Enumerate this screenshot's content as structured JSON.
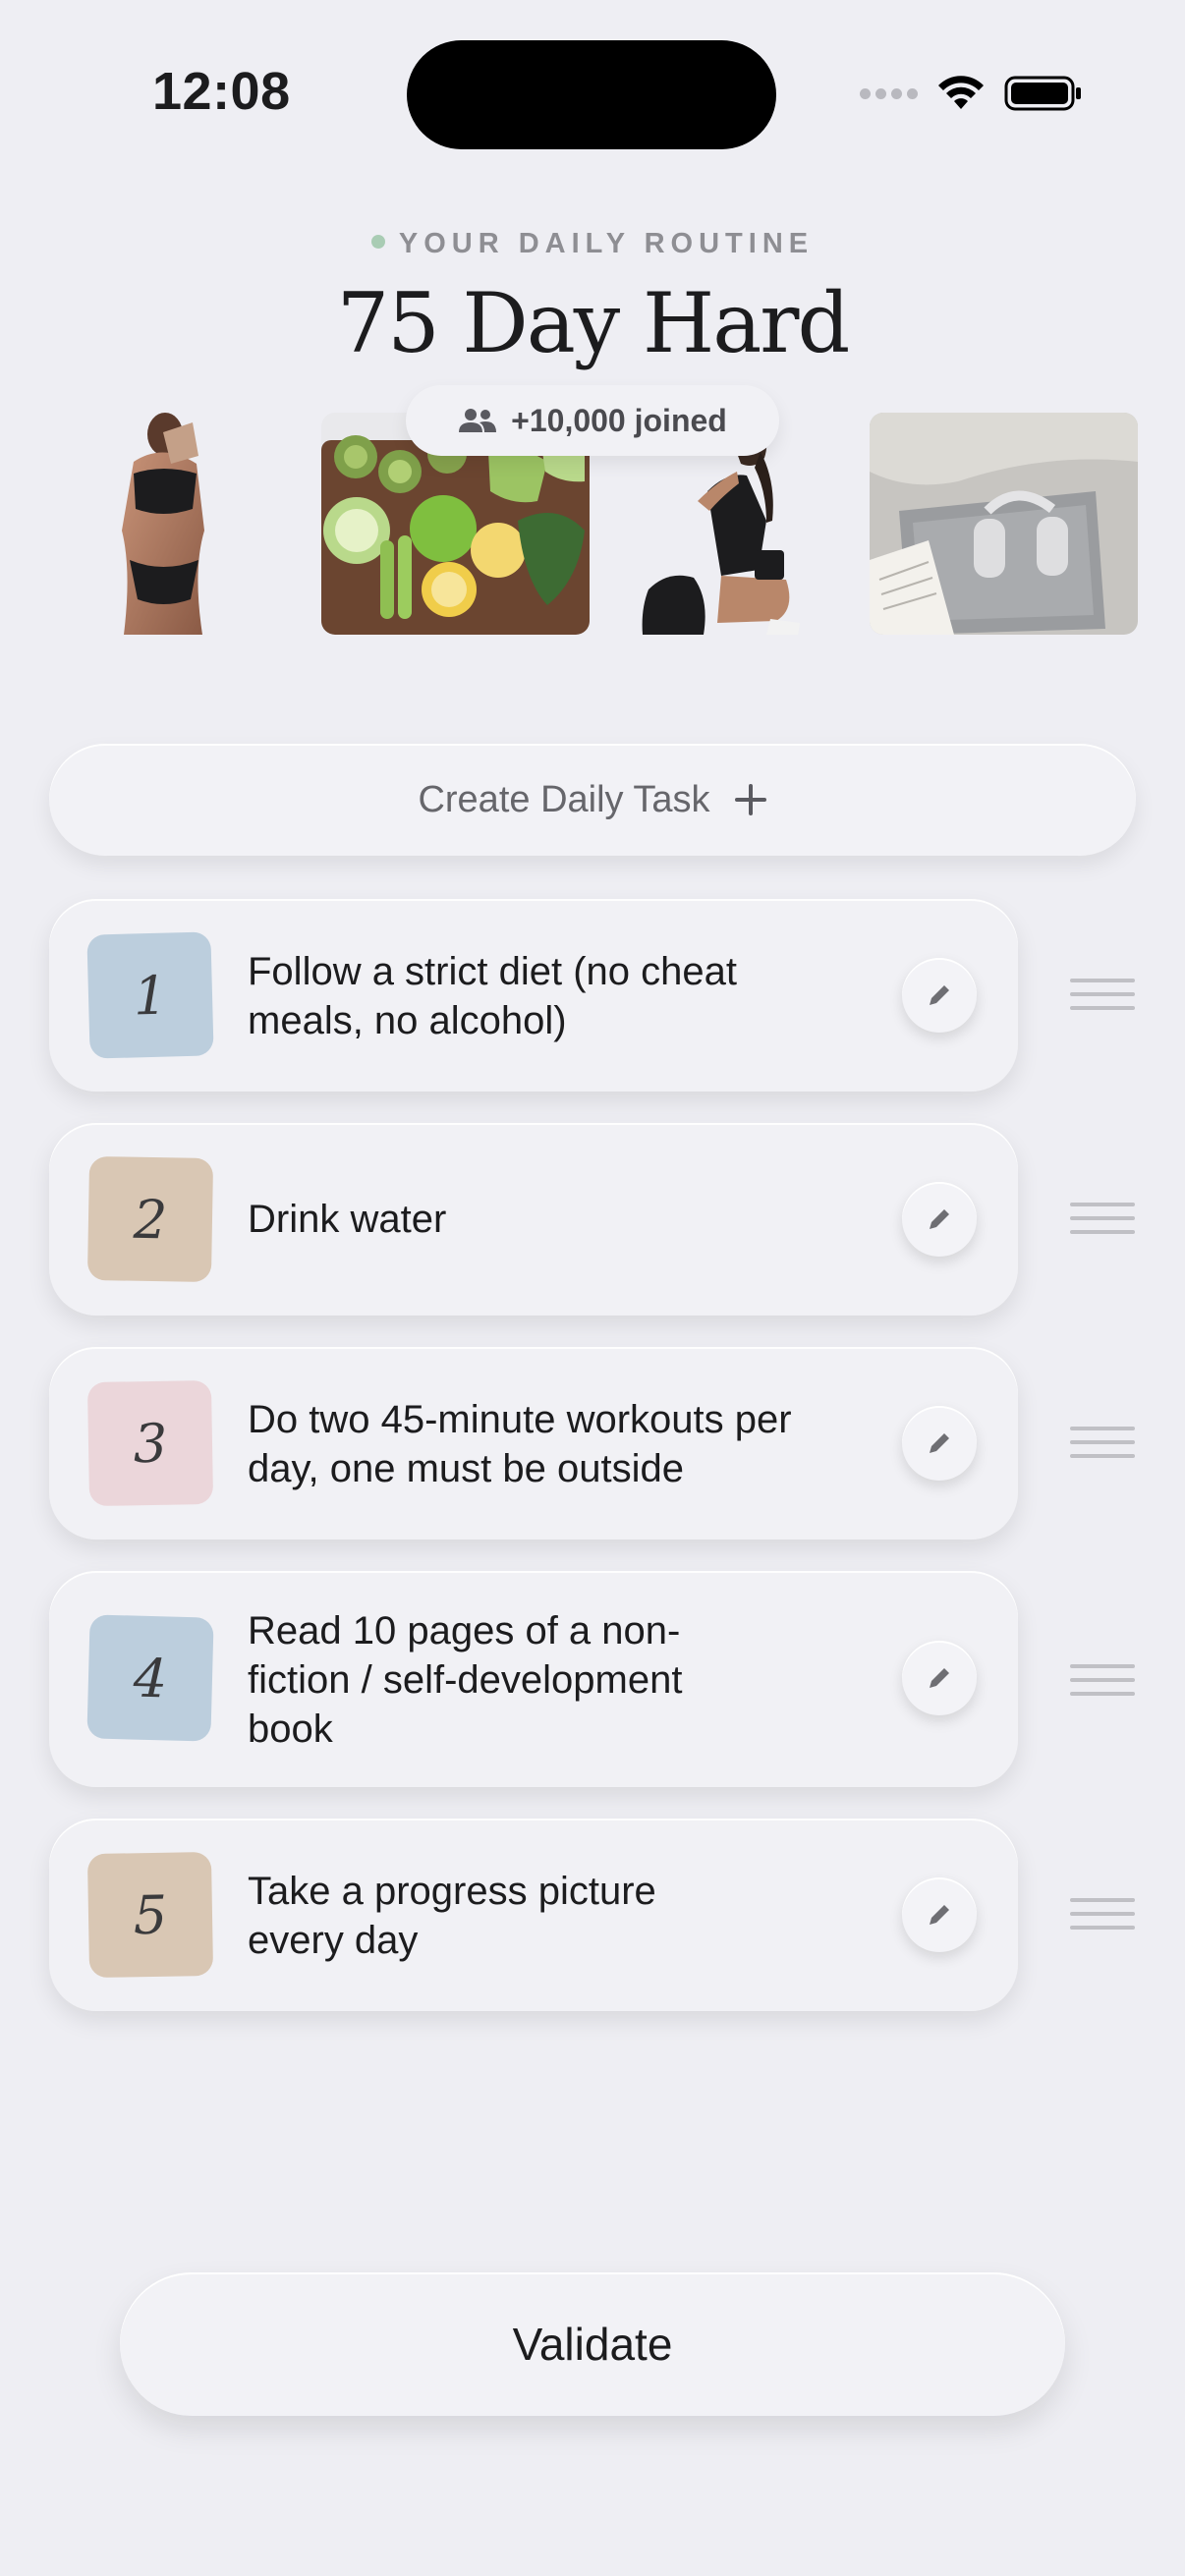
{
  "status_bar": {
    "time": "12:08"
  },
  "header": {
    "eyebrow": "YOUR DAILY ROUTINE",
    "title": "75 Day Hard",
    "joined": "+10,000 joined"
  },
  "photos": [
    {
      "name": "woman-body-photo"
    },
    {
      "name": "healthy-food-photo"
    },
    {
      "name": "workout-woman-photo"
    },
    {
      "name": "laptop-headphones-book-photo"
    }
  ],
  "create_button": {
    "label": "Create Daily Task"
  },
  "tasks": [
    {
      "number": "1",
      "text": "Follow a strict diet (no cheat meals, no alcohol)",
      "color": "#bccedd"
    },
    {
      "number": "2",
      "text": "Drink water",
      "color": "#d9c7b4"
    },
    {
      "number": "3",
      "text": "Do two 45-minute workouts per day, one must be outside",
      "color": "#ebd6da"
    },
    {
      "number": "4",
      "text": "Read 10 pages of a non-fiction / self-development book",
      "color": "#bccedd"
    },
    {
      "number": "5",
      "text": "Take a progress picture every day",
      "color": "#d9c7b4"
    }
  ],
  "validate_button": {
    "label": "Validate"
  },
  "icons": {
    "group": "group-icon",
    "plus": "plus-icon",
    "edit": "pencil-icon",
    "drag": "drag-handle-icon",
    "wifi": "wifi-icon",
    "battery": "battery-icon"
  }
}
